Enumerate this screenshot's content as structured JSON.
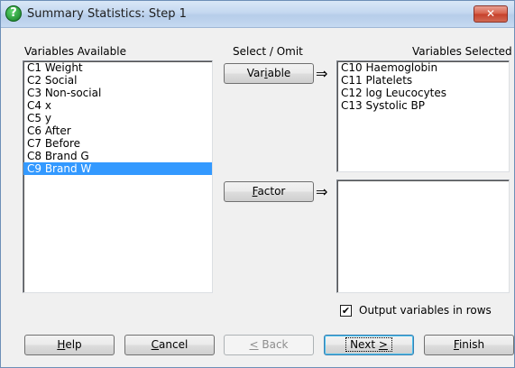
{
  "window": {
    "title": "Summary Statistics: Step 1",
    "close_symbol": "✕"
  },
  "available": {
    "header": "Variables Available",
    "items": [
      "C1 Weight",
      "C2 Social",
      "C3 Non-social",
      "C4 x",
      "C5 y",
      "C6 After",
      "C7 Before",
      "C8 Brand G",
      "C9 Brand W"
    ],
    "selected_index": 8
  },
  "middle": {
    "header": "Select / Omit",
    "variable_button": "Variable",
    "factor_button": "Factor",
    "arrow": "⇒"
  },
  "selected": {
    "header": "Variables Selected",
    "items": [
      "C10 Haemoglobin",
      "C11 Platelets",
      "C12 log Leucocytes",
      "C13 Systolic BP"
    ]
  },
  "factor_list": {
    "items": []
  },
  "options": {
    "output_in_rows_label": "Output variables in rows",
    "output_in_rows_checked": true,
    "check_mark": "✔"
  },
  "buttons": {
    "help": "Help",
    "cancel": "Cancel",
    "back": "< Back",
    "next": "Next >",
    "finish": "Finish"
  }
}
